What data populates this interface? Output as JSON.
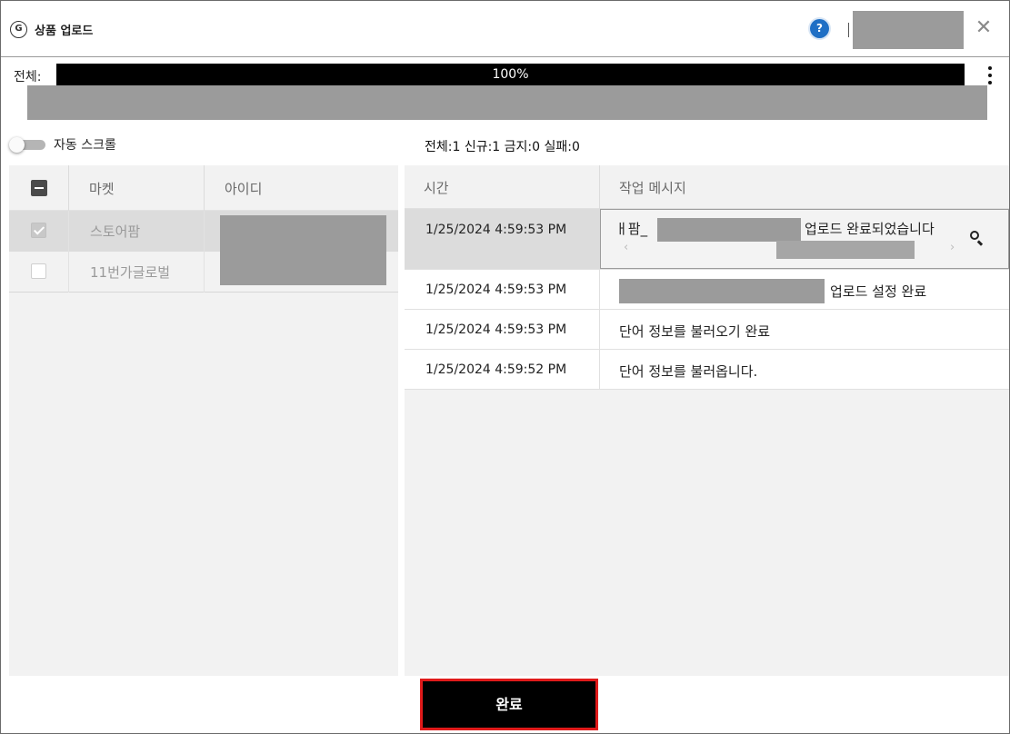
{
  "window": {
    "title": "상품 업로드",
    "app_icon_glyph": "G",
    "help_glyph": "?",
    "close_glyph": "✕",
    "title_separator": "|"
  },
  "progress": {
    "label": "전체:",
    "percent_text": "100%",
    "fraction": 1.0
  },
  "auto_scroll": {
    "label": "자동 스크롤",
    "enabled": false
  },
  "stats": "전체:1 신규:1 금지:0 실패:0",
  "markets": {
    "columns": {
      "market": "마켓",
      "id": "아이디"
    },
    "rows": [
      {
        "name": "스토어팜",
        "checked": true,
        "selected": true
      },
      {
        "name": "11번가글로벌",
        "checked": false,
        "selected": false
      }
    ]
  },
  "log": {
    "columns": {
      "time": "시간",
      "message": "작업 메시지"
    },
    "rows": [
      {
        "time": "1/25/2024 4:59:53 PM",
        "message_prefix": "ㅐ팜_",
        "message": "업로드 완료되었습니다",
        "editing": true
      },
      {
        "time": "1/25/2024 4:59:53 PM",
        "message": "업로드 설정 완료",
        "redacted_prefix": true
      },
      {
        "time": "1/25/2024 4:59:53 PM",
        "message": "단어 정보를 불러오기 완료"
      },
      {
        "time": "1/25/2024 4:59:52 PM",
        "message": "단어 정보를 불러옵니다."
      }
    ],
    "scroll_left_glyph": "‹",
    "scroll_right_glyph": "›"
  },
  "footer": {
    "done_label": "완료"
  },
  "colors": {
    "progress_fill": "#000000",
    "done_border": "#e01a1a",
    "help_blue": "#1f6fc5",
    "redaction_gray": "#9b9b9b"
  },
  "icons": [
    "app-logo-icon",
    "help-icon",
    "close-icon",
    "kebab-menu-icon",
    "search-icon"
  ]
}
